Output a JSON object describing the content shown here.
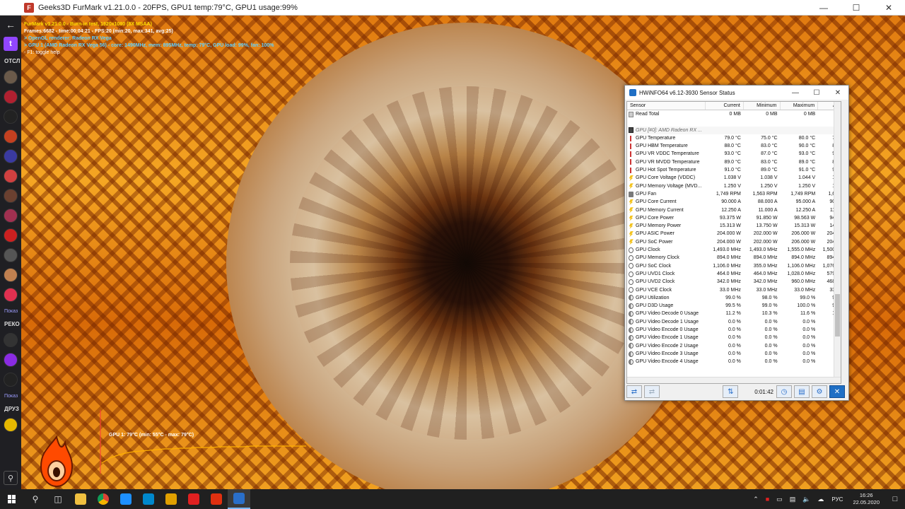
{
  "furmark_window": {
    "title": "Geeks3D FurMark v1.21.0.0 - 20FPS, GPU1 temp:79°C, GPU1 usage:99%",
    "overlay_lines": [
      "FurMark v1.21.0.0 - Burn-in test, 1920x1080 (8X MSAA)",
      "Frames:6682 - time:00:04:21 - FPS:20 (min:20, max:341, avg:25)",
      "> OpenGL renderer: Radeon RX Vega",
      "> GPU 1 (AMD Radeon RX Vega 56) - core: 1490MHz, mem: 895MHz, temp: 79°C, GPU load: 99%, fan: 100%",
      "- F1: toggle help"
    ],
    "graph_label": "GPU 1: 79°C (min: 55°C - max: 79°C)",
    "graph_data": {
      "type": "line",
      "series": [
        {
          "values": [
            55,
            62,
            66,
            69,
            71,
            72,
            73,
            74,
            75,
            75,
            76,
            76,
            77,
            77,
            77,
            78,
            78,
            78,
            78,
            79,
            79,
            79,
            79,
            79,
            79,
            79,
            79
          ]
        }
      ],
      "ylim": [
        40,
        100
      ]
    }
  },
  "sidebar": {
    "section_following": "ОТСЛ",
    "show_more_1": "Показ",
    "section_recommended": "РЕКО",
    "show_more_2": "Показ",
    "section_friends": "ДРУЗ",
    "avatars": [
      "#6b5a4a",
      "#b02030",
      "#222",
      "#c44020",
      "#3a3aa0",
      "#d04040",
      "#6a4030",
      "#a03050",
      "#cc2020",
      "#555",
      "#c08050",
      "#e03050"
    ],
    "avatars2": [
      "#333",
      "#8a2be2",
      "#222"
    ]
  },
  "hwinfo": {
    "title": "HWiNFO64 v6.12-3930 Sensor Status",
    "columns": [
      "Sensor",
      "Current",
      "Minimum",
      "Maximum",
      "Av"
    ],
    "read_total": {
      "label": "Read Total",
      "current": "0 MB",
      "min": "0 MB",
      "max": "0 MB",
      "avg": ""
    },
    "group": "GPU [#0]: AMD Radeon RX ...",
    "rows": [
      {
        "icon": "temp",
        "label": "GPU Temperature",
        "current": "79.0 °C",
        "min": "75.0 °C",
        "max": "80.0 °C",
        "avg": "7..."
      },
      {
        "icon": "temp",
        "label": "GPU HBM Temperature",
        "current": "88.0 °C",
        "min": "83.0 °C",
        "max": "90.0 °C",
        "avg": "8..."
      },
      {
        "icon": "temp",
        "label": "GPU VR VDDC Temperature",
        "current": "93.0 °C",
        "min": "87.0 °C",
        "max": "93.0 °C",
        "avg": "9..."
      },
      {
        "icon": "temp",
        "label": "GPU VR MVDD Temperature",
        "current": "89.0 °C",
        "min": "83.0 °C",
        "max": "89.0 °C",
        "avg": "8..."
      },
      {
        "icon": "temp",
        "label": "GPU Hot Spot Temperature",
        "current": "91.0 °C",
        "min": "89.0 °C",
        "max": "91.0 °C",
        "avg": "9..."
      },
      {
        "icon": "volt",
        "label": "GPU Core Voltage (VDDC)",
        "current": "1.038 V",
        "min": "1.038 V",
        "max": "1.044 V",
        "avg": "1..."
      },
      {
        "icon": "volt",
        "label": "GPU Memory Voltage (MVD...",
        "current": "1.250 V",
        "min": "1.250 V",
        "max": "1.250 V",
        "avg": "1..."
      },
      {
        "icon": "fan",
        "label": "GPU Fan",
        "current": "1,749 RPM",
        "min": "1,563 RPM",
        "max": "1,749 RPM",
        "avg": "1,6..."
      },
      {
        "icon": "volt",
        "label": "GPU Core Current",
        "current": "90.000 A",
        "min": "88.000 A",
        "max": "95.000 A",
        "avg": "90..."
      },
      {
        "icon": "volt",
        "label": "GPU Memory Current",
        "current": "12.250 A",
        "min": "11.000 A",
        "max": "12.250 A",
        "avg": "11..."
      },
      {
        "icon": "volt",
        "label": "GPU Core Power",
        "current": "93.375 W",
        "min": "91.850 W",
        "max": "98.563 W",
        "avg": "94..."
      },
      {
        "icon": "volt",
        "label": "GPU Memory Power",
        "current": "15.313 W",
        "min": "13.750 W",
        "max": "15.313 W",
        "avg": "14..."
      },
      {
        "icon": "volt",
        "label": "GPU ASIC Power",
        "current": "204.000 W",
        "min": "202.000 W",
        "max": "206.000 W",
        "avg": "204..."
      },
      {
        "icon": "volt",
        "label": "GPU SoC Power",
        "current": "204.000 W",
        "min": "202.000 W",
        "max": "206.000 W",
        "avg": "204..."
      },
      {
        "icon": "clock",
        "label": "GPU Clock",
        "current": "1,493.0 MHz",
        "min": "1,493.0 MHz",
        "max": "1,555.0 MHz",
        "avg": "1,500..."
      },
      {
        "icon": "clock",
        "label": "GPU Memory Clock",
        "current": "894.0 MHz",
        "min": "894.0 MHz",
        "max": "894.0 MHz",
        "avg": "894..."
      },
      {
        "icon": "clock",
        "label": "GPU SoC Clock",
        "current": "1,106.0 MHz",
        "min": "355.0 MHz",
        "max": "1,106.0 MHz",
        "avg": "1,076..."
      },
      {
        "icon": "clock",
        "label": "GPU UVD1 Clock",
        "current": "464.0 MHz",
        "min": "464.0 MHz",
        "max": "1,028.0 MHz",
        "avg": "579..."
      },
      {
        "icon": "clock",
        "label": "GPU UVD2 Clock",
        "current": "342.0 MHz",
        "min": "342.0 MHz",
        "max": "960.0 MHz",
        "avg": "468..."
      },
      {
        "icon": "clock",
        "label": "GPU VCE Clock",
        "current": "33.0 MHz",
        "min": "33.0 MHz",
        "max": "33.0 MHz",
        "avg": "33..."
      },
      {
        "icon": "util",
        "label": "GPU Utilization",
        "current": "99.0 %",
        "min": "98.0 %",
        "max": "99.0 %",
        "avg": "9..."
      },
      {
        "icon": "util",
        "label": "GPU D3D Usage",
        "current": "99.5 %",
        "min": "99.0 %",
        "max": "100.0 %",
        "avg": "9..."
      },
      {
        "icon": "util",
        "label": "GPU Video Decode 0 Usage",
        "current": "11.2 %",
        "min": "10.3 %",
        "max": "11.6 %",
        "avg": "1..."
      },
      {
        "icon": "util",
        "label": "GPU Video Decode 1 Usage",
        "current": "0.0 %",
        "min": "0.0 %",
        "max": "0.0 %",
        "avg": "..."
      },
      {
        "icon": "util",
        "label": "GPU Video Encode 0 Usage",
        "current": "0.0 %",
        "min": "0.0 %",
        "max": "0.0 %",
        "avg": "..."
      },
      {
        "icon": "util",
        "label": "GPU Video Encode 1 Usage",
        "current": "0.0 %",
        "min": "0.0 %",
        "max": "0.0 %",
        "avg": "..."
      },
      {
        "icon": "util",
        "label": "GPU Video Encode 2 Usage",
        "current": "0.0 %",
        "min": "0.0 %",
        "max": "0.0 %",
        "avg": "..."
      },
      {
        "icon": "util",
        "label": "GPU Video Encode 3 Usage",
        "current": "0.0 %",
        "min": "0.0 %",
        "max": "0.0 %",
        "avg": "..."
      },
      {
        "icon": "util",
        "label": "GPU Video Encode 4 Usage",
        "current": "0.0 %",
        "min": "0.0 %",
        "max": "0.0 %",
        "avg": "..."
      }
    ],
    "elapsed": "0:01:42"
  },
  "taskbar": {
    "lang": "РУС",
    "time": "16:26",
    "date": "22.05.2020",
    "apps": [
      "#1e90ff",
      "#0088cc",
      "#e0a000",
      "#e02020",
      "#e03010",
      "#2a6fc9"
    ]
  }
}
